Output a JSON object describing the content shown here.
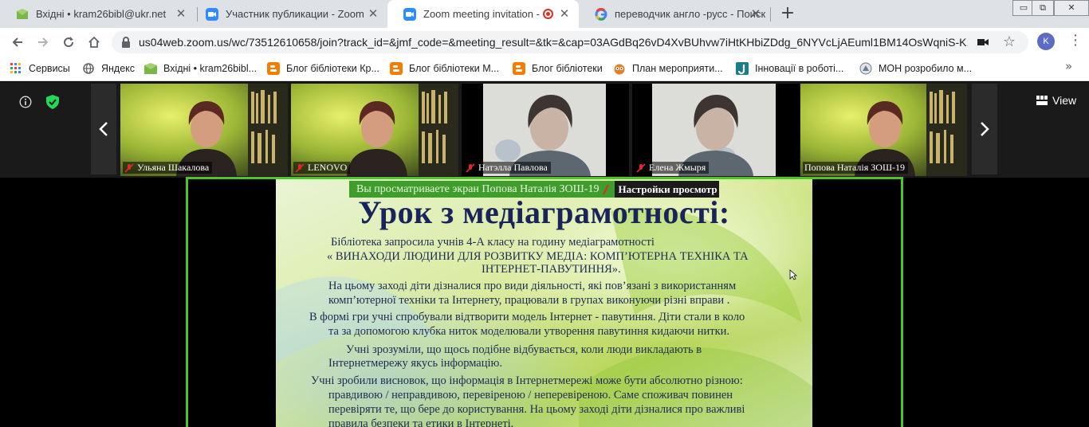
{
  "tabs": [
    {
      "title": "Вхідні • kram26bibl@ukr.net",
      "icon": "mail-icon",
      "close": "✕"
    },
    {
      "title": "Участник публикации - Zoom",
      "icon": "zoom-icon",
      "close": "✕"
    },
    {
      "title": "Zoom meeting invitation - Z",
      "icon": "zoom-icon",
      "close": "✕",
      "active": true
    },
    {
      "title": "переводчик англо -русс - Поиск",
      "icon": "google-icon",
      "close": "✕"
    }
  ],
  "new_tab": "+",
  "window_controls": [
    "▭",
    "⧉",
    "✕"
  ],
  "address": {
    "url": "us04web.zoom.us/wc/73512610658/join?track_id=&jmf_code=&meeting_result=&tk=&cap=03AGdBq26vD4XvBUhvw7iHtKHbiZDdg_6NYVcLjAEuml1BM14OsWqniS-K..."
  },
  "profile_initial": "K",
  "bookmarks": [
    {
      "label": "Сервисы",
      "icon": "apps-grid-icon"
    },
    {
      "label": "Яндекс",
      "icon": "globe-icon"
    },
    {
      "label": "Вхідні • kram26bibl...",
      "icon": "mail-icon"
    },
    {
      "label": "Блог бібліотеки Кр...",
      "icon": "blogger-icon"
    },
    {
      "label": "Блог бібліотеки М...",
      "icon": "blogger-icon"
    },
    {
      "label": "Блог бібліотеки",
      "icon": "blogger-icon"
    },
    {
      "label": "План мероприяти...",
      "icon": "owl-icon"
    },
    {
      "label": "Інновації в роботі...",
      "icon": "j-icon"
    },
    {
      "label": "МОН розробило м...",
      "icon": "mon-icon"
    }
  ],
  "bookmarks_more": "»",
  "zoom": {
    "view_label": "View",
    "participants": [
      {
        "name": "Ульяна Шакалова",
        "muted": true
      },
      {
        "name": "LENOVO",
        "muted": true
      },
      {
        "name": "Натэлла Павлова",
        "muted": true
      },
      {
        "name": "Елена Жмыря",
        "muted": true
      },
      {
        "name": "Попова Наталія ЗОШ-19",
        "muted": false
      }
    ],
    "sharing_text": "Вы просматриваете экран Попова Наталія ЗОШ-19",
    "view_options": "Настройки просмотр"
  },
  "slide": {
    "title": "Урок з медіаграмотності:",
    "lines": [
      "Бібліотека запросила учнів 4-А класу  на годину медіаграмотності",
      "« ВИНАХОДИ ЛЮДИНИ ДЛЯ РОЗВИТКУ МЕДІА: КОМП’ЮТЕРНА ТЕХНІКА ТА",
      "ІНТЕРНЕТ-ПАВУТИННЯ».",
      "На цьому заході діти дізналися про види діяльності, які пов’язані з використанням",
      "комп’ютерної техніки та Інтернету,  працювали в групах виконуючи різні вправи .",
      "В формі гри учні спробували відтворити модель Інтернет - павутиння. Діти  стали в коло",
      "та за допомогою клубка  ниток моделювали утворення павутиння кидаючи нитки.",
      "Учні зрозуміли, що щось подібне відбувається, коли люди викладають в",
      "Інтернетмережу якусь інформацію.",
      "Учні зробили  висновок, що інформація в Інтернетмережі  може бути абсолютно різною:",
      "правдивою / неправдивою, перевіреною / неперевіреною.  Саме споживач повинен",
      "перевіряти те, що бере до користування.  На цьому заході діти дізналися про важливі",
      "правила безпеки та етики в Інтернеті."
    ]
  }
}
